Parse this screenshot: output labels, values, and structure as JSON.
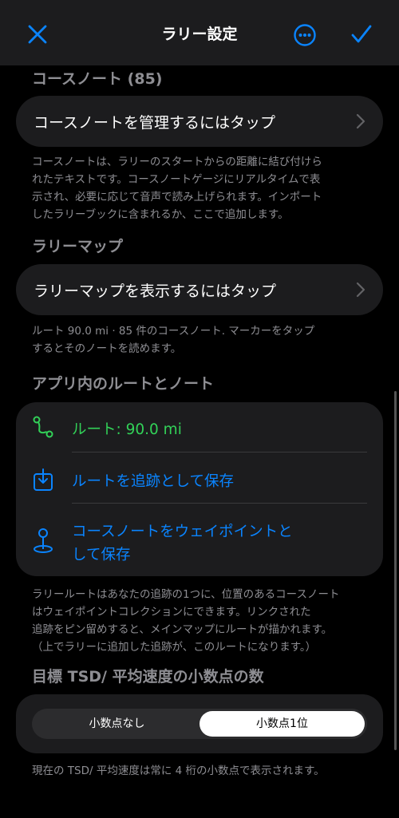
{
  "header": {
    "title": "ラリー設定",
    "close_icon": "close-icon",
    "more_icon": "ellipsis-circle-icon",
    "confirm_icon": "checkmark-icon"
  },
  "course_notes": {
    "section_title": "コースノート (85)",
    "button_label": "コースノートを管理するにはタップ",
    "description_lines": [
      "コースノートは、ラリーのスタートからの距離に結び付けら",
      "れたテキストです。コースノートゲージにリアルタイムで表",
      "示され、必要に応じて音声で読み上げられます。インポート",
      "したラリーブックに含まれるか、ここで追加します。"
    ]
  },
  "rally_map": {
    "section_title": "ラリーマップ",
    "button_label": "ラリーマップを表示するにはタップ",
    "description_lines": [
      "ルート 90.0 mi · 85 件のコースノート. マーカーをタップ",
      "するとそのノートを読めます。"
    ]
  },
  "in_app": {
    "section_title": "アプリ内のルートとノート",
    "route_label": "ルート: 90.0 mi",
    "save_track_label": "ルートを追跡として保存",
    "save_waypoints_lines": [
      "コースノートをウェイポイントと",
      "して保存"
    ],
    "description_lines": [
      "ラリールートはあなたの追跡の1つに、位置のあるコースノート",
      "はウェイポイントコレクションにできます。リンクされた",
      "追跡をピン留めすると、メインマップにルートが描かれます。",
      "（上でラリーに追加した追跡が、このルートになります。）"
    ]
  },
  "decimals": {
    "section_title": "目標 TSD/ 平均速度の小数点の数",
    "options": [
      "小数点なし",
      "小数点1位"
    ],
    "selected": "小数点1位",
    "description": "現在の TSD/ 平均速度は常に 4 桁の小数点で表示されます。"
  },
  "colors": {
    "accent": "#0a84ff",
    "green": "#32d158",
    "background": "#000000",
    "card": "#1c1c1e"
  }
}
